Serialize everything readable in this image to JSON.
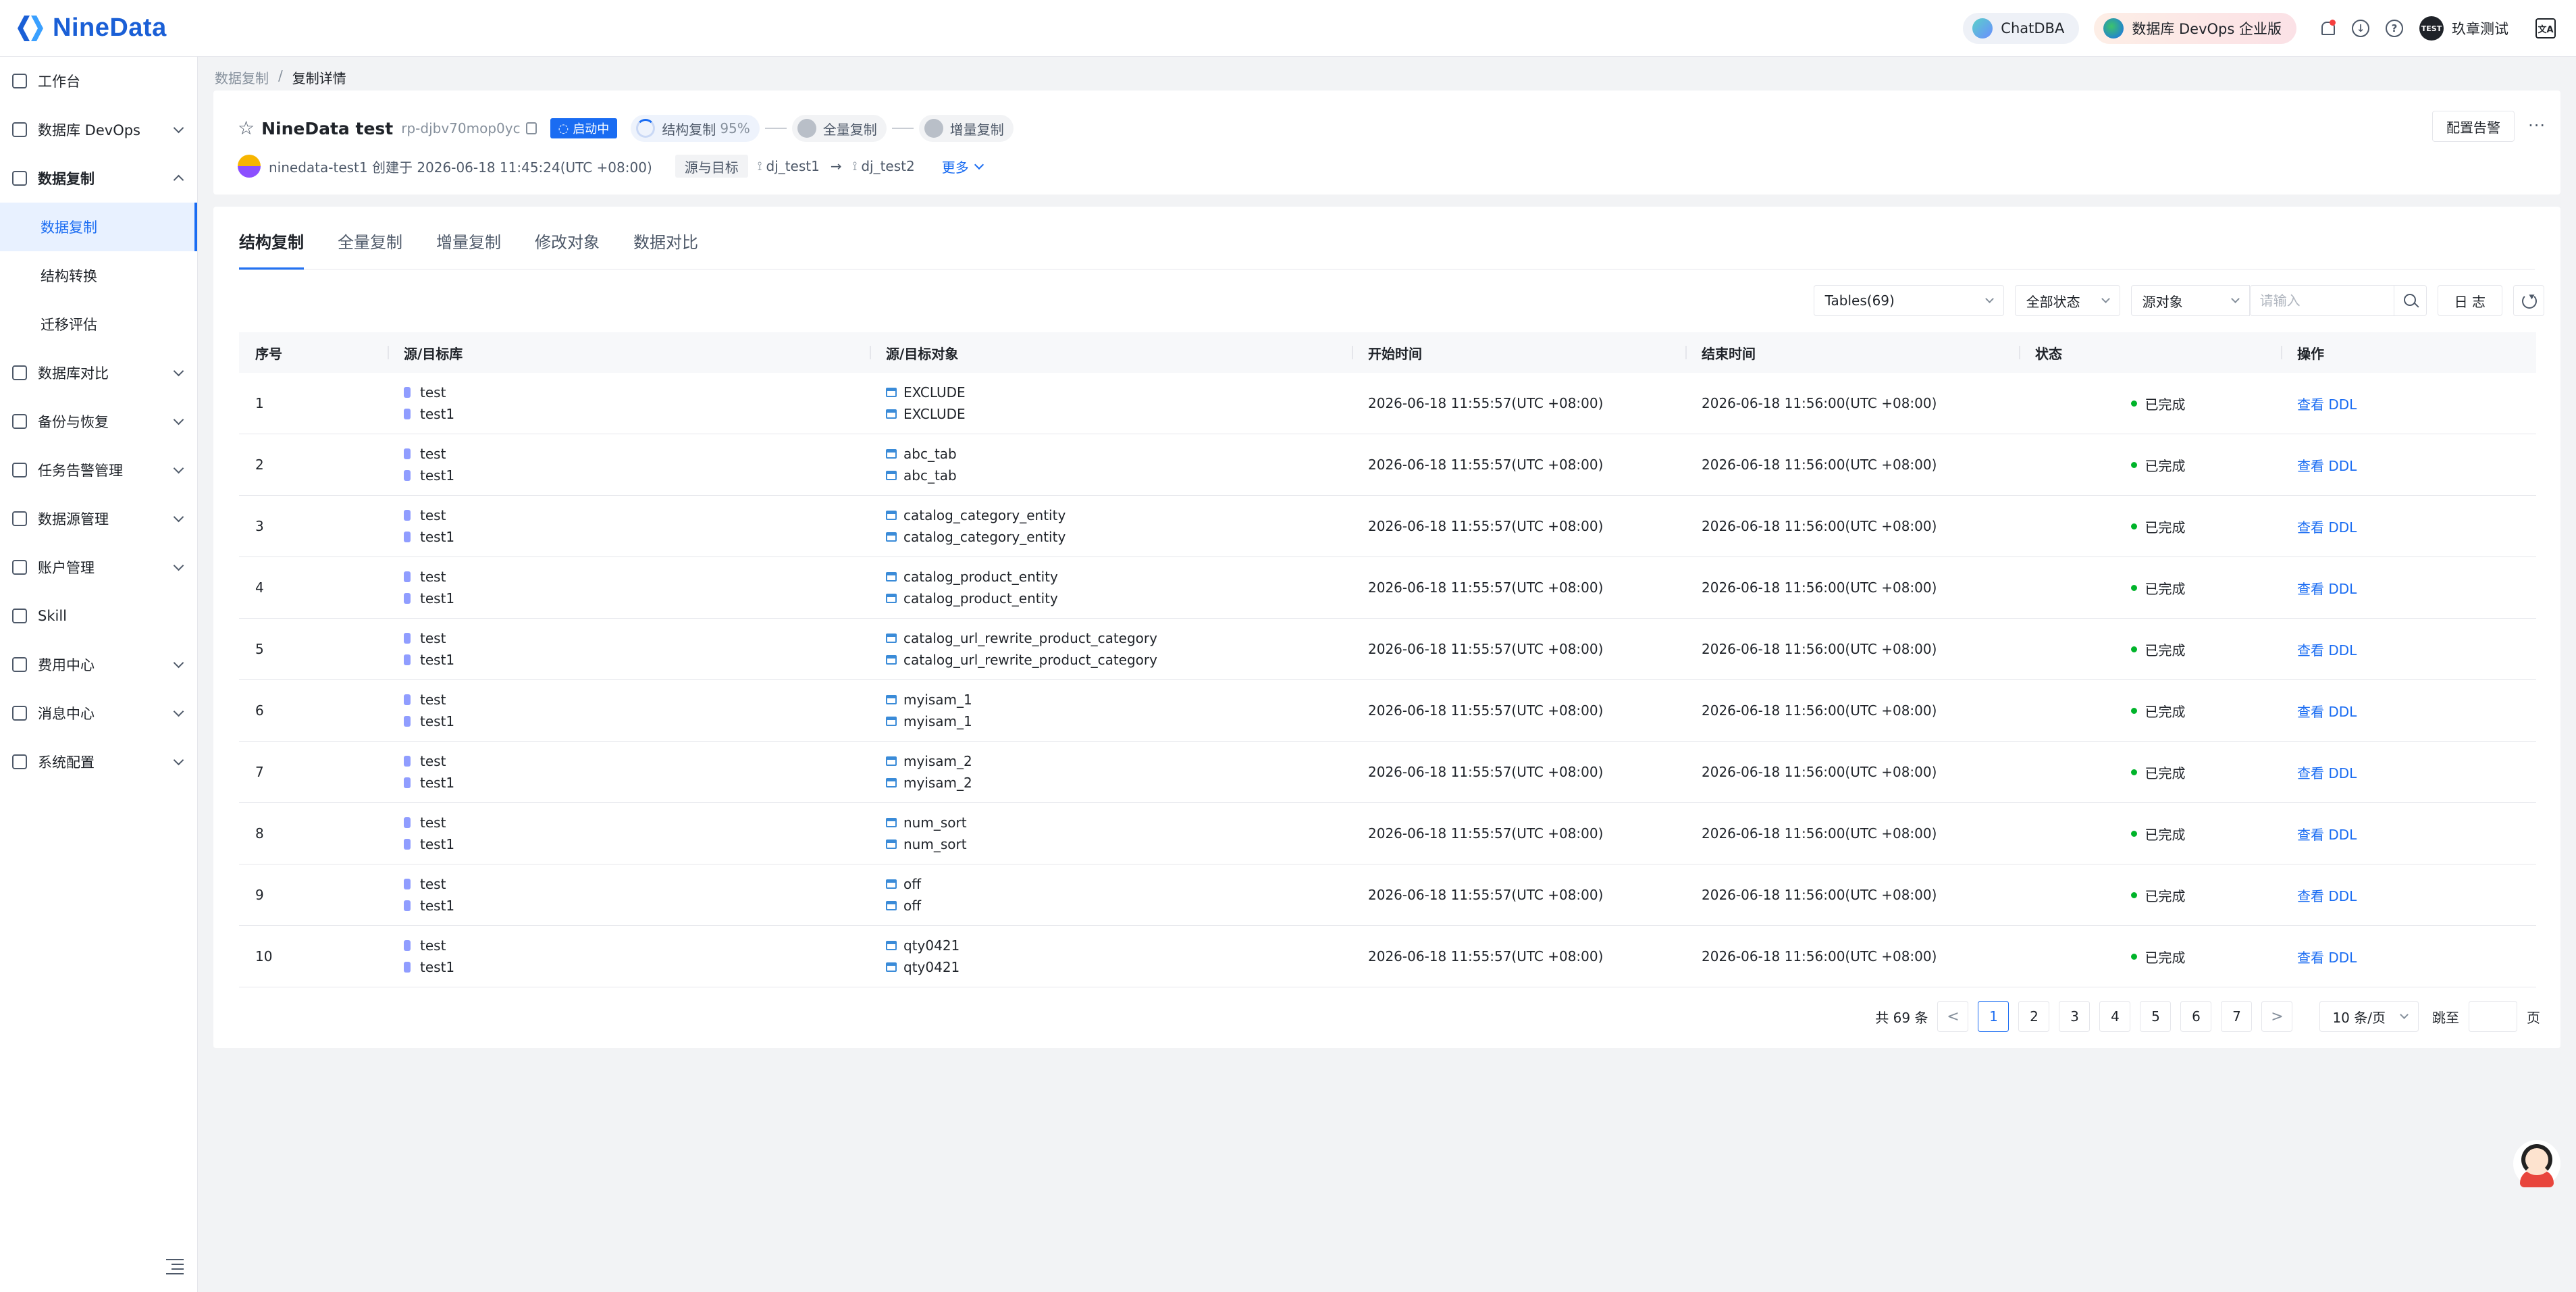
{
  "brand": {
    "name": "NineData"
  },
  "topbar": {
    "chatdba": "ChatDBA",
    "edition": "数据库 DevOps 企业版",
    "avatar_text": "TEST",
    "user_name": "玖章测试",
    "lang_icon": "translate-icon"
  },
  "sidebar": {
    "items": [
      {
        "label": "工作台",
        "icon": "home-icon"
      },
      {
        "label": "数据库 DevOps",
        "icon": "devops-icon"
      },
      {
        "label": "数据复制",
        "icon": "replication-icon"
      },
      {
        "label": "数据复制"
      },
      {
        "label": "结构转换"
      },
      {
        "label": "迁移评估"
      },
      {
        "label": "数据库对比",
        "icon": "compare-icon"
      },
      {
        "label": "备份与恢复",
        "icon": "backup-icon"
      },
      {
        "label": "任务告警管理",
        "icon": "alarm-icon"
      },
      {
        "label": "数据源管理",
        "icon": "datasource-icon"
      },
      {
        "label": "账户管理",
        "icon": "account-icon"
      },
      {
        "label": "Skill",
        "icon": "skill-icon"
      },
      {
        "label": "费用中心",
        "icon": "billing-icon"
      },
      {
        "label": "消息中心",
        "icon": "message-icon"
      },
      {
        "label": "系统配置",
        "icon": "settings-icon"
      }
    ]
  },
  "breadcrumb": {
    "parent": "数据复制",
    "separator": "/",
    "current": "复制详情"
  },
  "task": {
    "title": "NineData test",
    "id": "rp-djbv70mop0yc",
    "status": "启动中",
    "steps": [
      {
        "label": "结构复制",
        "progress": "95%"
      },
      {
        "label": "全量复制"
      },
      {
        "label": "增量复制"
      }
    ],
    "created": "ninedata-test1 创建于 2026-06-18 11:45:24(UTC +08:00)",
    "src_target_label": "源与目标",
    "source": "dj_test1",
    "target": "dj_test2",
    "more": "更多",
    "alarm_button": "配置告警",
    "more_dots": "···"
  },
  "tabs": [
    "结构复制",
    "全量复制",
    "增量复制",
    "修改对象",
    "数据对比"
  ],
  "filters": {
    "tables": "Tables(69)",
    "status": "全部状态",
    "object": "源对象",
    "search_placeholder": "请输入",
    "log": "日 志"
  },
  "table": {
    "headers": [
      "序号",
      "源/目标库",
      "源/目标对象",
      "开始时间",
      "结束时间",
      "状态",
      "操作"
    ],
    "rows": [
      {
        "no": "1",
        "src_db": "test",
        "dst_db": "test1",
        "src_obj": "EXCLUDE",
        "dst_obj": "EXCLUDE",
        "start": "2026-06-18 11:55:57(UTC +08:00)",
        "end": "2026-06-18 11:56:00(UTC +08:00)",
        "status": "已完成",
        "op": "查看 DDL"
      },
      {
        "no": "2",
        "src_db": "test",
        "dst_db": "test1",
        "src_obj": "abc_tab",
        "dst_obj": "abc_tab",
        "start": "2026-06-18 11:55:57(UTC +08:00)",
        "end": "2026-06-18 11:56:00(UTC +08:00)",
        "status": "已完成",
        "op": "查看 DDL"
      },
      {
        "no": "3",
        "src_db": "test",
        "dst_db": "test1",
        "src_obj": "catalog_category_entity",
        "dst_obj": "catalog_category_entity",
        "start": "2026-06-18 11:55:57(UTC +08:00)",
        "end": "2026-06-18 11:56:00(UTC +08:00)",
        "status": "已完成",
        "op": "查看 DDL"
      },
      {
        "no": "4",
        "src_db": "test",
        "dst_db": "test1",
        "src_obj": "catalog_product_entity",
        "dst_obj": "catalog_product_entity",
        "start": "2026-06-18 11:55:57(UTC +08:00)",
        "end": "2026-06-18 11:56:00(UTC +08:00)",
        "status": "已完成",
        "op": "查看 DDL"
      },
      {
        "no": "5",
        "src_db": "test",
        "dst_db": "test1",
        "src_obj": "catalog_url_rewrite_product_category",
        "dst_obj": "catalog_url_rewrite_product_category",
        "start": "2026-06-18 11:55:57(UTC +08:00)",
        "end": "2026-06-18 11:56:00(UTC +08:00)",
        "status": "已完成",
        "op": "查看 DDL"
      },
      {
        "no": "6",
        "src_db": "test",
        "dst_db": "test1",
        "src_obj": "myisam_1",
        "dst_obj": "myisam_1",
        "start": "2026-06-18 11:55:57(UTC +08:00)",
        "end": "2026-06-18 11:56:00(UTC +08:00)",
        "status": "已完成",
        "op": "查看 DDL"
      },
      {
        "no": "7",
        "src_db": "test",
        "dst_db": "test1",
        "src_obj": "myisam_2",
        "dst_obj": "myisam_2",
        "start": "2026-06-18 11:55:57(UTC +08:00)",
        "end": "2026-06-18 11:56:00(UTC +08:00)",
        "status": "已完成",
        "op": "查看 DDL"
      },
      {
        "no": "8",
        "src_db": "test",
        "dst_db": "test1",
        "src_obj": "num_sort",
        "dst_obj": "num_sort",
        "start": "2026-06-18 11:55:57(UTC +08:00)",
        "end": "2026-06-18 11:56:00(UTC +08:00)",
        "status": "已完成",
        "op": "查看 DDL"
      },
      {
        "no": "9",
        "src_db": "test",
        "dst_db": "test1",
        "src_obj": "off",
        "dst_obj": "off",
        "start": "2026-06-18 11:55:57(UTC +08:00)",
        "end": "2026-06-18 11:56:00(UTC +08:00)",
        "status": "已完成",
        "op": "查看 DDL"
      },
      {
        "no": "10",
        "src_db": "test",
        "dst_db": "test1",
        "src_obj": "qty0421",
        "dst_obj": "qty0421",
        "start": "2026-06-18 11:55:57(UTC +08:00)",
        "end": "2026-06-18 11:56:00(UTC +08:00)",
        "status": "已完成",
        "op": "查看 DDL"
      }
    ]
  },
  "pagination": {
    "total": "共 69 条",
    "prev": "<",
    "next": ">",
    "pages": [
      "1",
      "2",
      "3",
      "4",
      "5",
      "6",
      "7"
    ],
    "current": "1",
    "page_size": "10 条/页",
    "jump_label": "跳至",
    "page_suffix": "页"
  },
  "colors": {
    "accent": "#1a6cf2",
    "success": "#00b42a",
    "brand": "#1a5fd6"
  }
}
